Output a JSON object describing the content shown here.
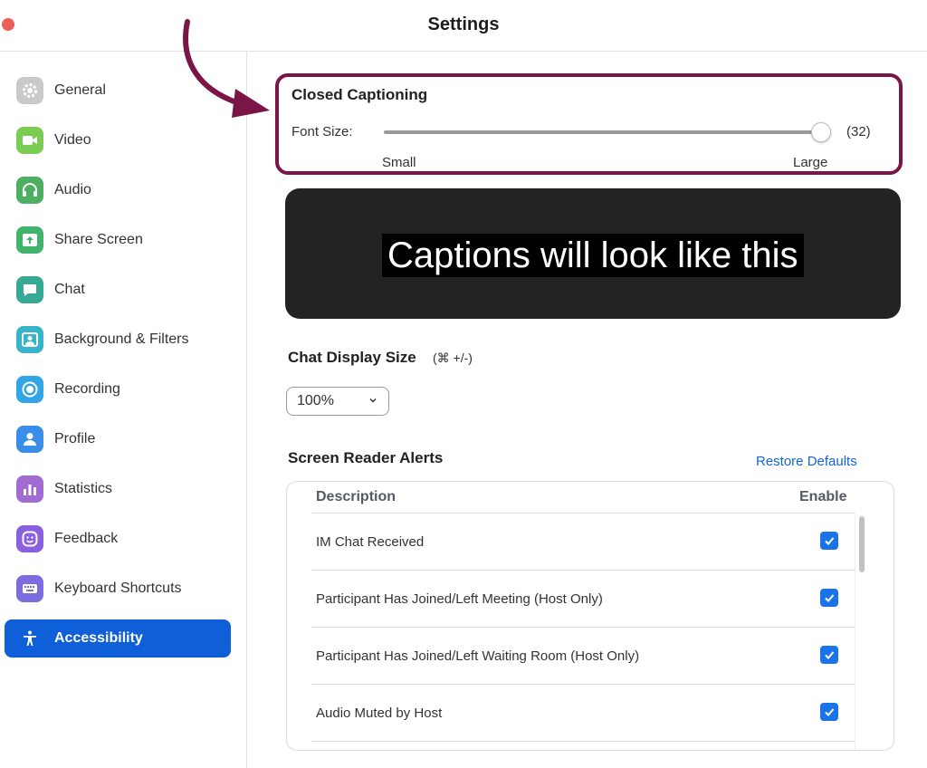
{
  "window": {
    "title": "Settings"
  },
  "sidebar": {
    "items": [
      {
        "label": "General",
        "icon": "gear-icon",
        "color": "#c9c9c9"
      },
      {
        "label": "Video",
        "icon": "video-camera-icon",
        "color": "#7ccb52"
      },
      {
        "label": "Audio",
        "icon": "headphones-icon",
        "color": "#4caf61"
      },
      {
        "label": "Share Screen",
        "icon": "share-screen-icon",
        "color": "#41b36a"
      },
      {
        "label": "Chat",
        "icon": "chat-bubble-icon",
        "color": "#37a995"
      },
      {
        "label": "Background & Filters",
        "icon": "background-person-icon",
        "color": "#37b4cc"
      },
      {
        "label": "Recording",
        "icon": "record-icon",
        "color": "#33a4e6"
      },
      {
        "label": "Profile",
        "icon": "profile-person-icon",
        "color": "#3a8ee8"
      },
      {
        "label": "Statistics",
        "icon": "bar-chart-icon",
        "color": "#a26bd1"
      },
      {
        "label": "Feedback",
        "icon": "smiley-icon",
        "color": "#8a5fe0"
      },
      {
        "label": "Keyboard Shortcuts",
        "icon": "keyboard-icon",
        "color": "#7b6ce0"
      },
      {
        "label": "Accessibility",
        "icon": "accessibility-person-icon",
        "color": "#0e5fd8",
        "active": true
      }
    ]
  },
  "closed_captioning": {
    "title": "Closed Captioning",
    "font_size_label": "Font Size:",
    "font_size_value": "(32)",
    "slider_level": 1.0,
    "min_label": "Small",
    "max_label": "Large",
    "preview_text": "Captions will look like this"
  },
  "chat_display": {
    "title": "Chat Display Size",
    "shortcut_hint": "(⌘ +/-)",
    "selected": "100%"
  },
  "screen_reader": {
    "title": "Screen Reader Alerts",
    "restore_label": "Restore Defaults",
    "col_description": "Description",
    "col_enable": "Enable",
    "rows": [
      {
        "label": "IM Chat Received",
        "enabled": true
      },
      {
        "label": "Participant Has Joined/Left Meeting (Host Only)",
        "enabled": true
      },
      {
        "label": "Participant Has Joined/Left Waiting Room (Host Only)",
        "enabled": true
      },
      {
        "label": "Audio Muted by Host",
        "enabled": true
      }
    ]
  },
  "colors": {
    "accent": "#0e5fd8",
    "annotation": "#7a1548",
    "checkbox": "#1a73e8",
    "link": "#1565d8"
  }
}
